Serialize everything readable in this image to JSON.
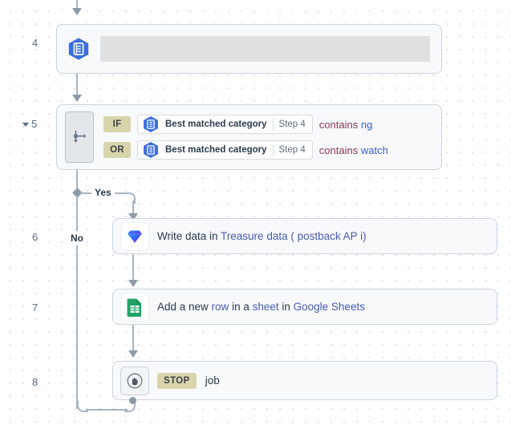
{
  "canvas": {
    "background_color": "#ffffff",
    "dot_color": "#dfe3e8"
  },
  "steps": [
    {
      "number": "4",
      "type": "loading",
      "icon": "blue-hexagon-document-icon",
      "collapsed_toggle": false,
      "placeholder_label": ""
    },
    {
      "number": "5",
      "type": "branch",
      "icon": "branch-fork-icon",
      "collapsed_toggle": true,
      "conditions": [
        {
          "logic": "IF",
          "field_icon": "blue-hexagon-document-icon",
          "field_name": "Best matched category",
          "field_step": "Step 4",
          "operator": "contains",
          "value": "ng"
        },
        {
          "logic": "OR",
          "field_icon": "blue-hexagon-document-icon",
          "field_name": "Best matched category",
          "field_step": "Step 4",
          "operator": "contains",
          "value": "watch"
        }
      ],
      "branches": [
        {
          "label": "Yes"
        },
        {
          "label": "No"
        }
      ]
    },
    {
      "number": "6",
      "type": "action",
      "icon": "treasure-data-gem-icon",
      "text_parts": [
        {
          "text": "Write data in ",
          "link": false
        },
        {
          "text": "Treasure data ( postback AP i)",
          "link": true
        }
      ]
    },
    {
      "number": "7",
      "type": "action",
      "icon": "google-sheets-icon",
      "text_parts": [
        {
          "text": "Add a new ",
          "link": false
        },
        {
          "text": "row",
          "link": true
        },
        {
          "text": " in a ",
          "link": false
        },
        {
          "text": "sheet",
          "link": true
        },
        {
          "text": " in ",
          "link": false
        },
        {
          "text": "Google Sheets",
          "link": true
        }
      ]
    },
    {
      "number": "8",
      "type": "stop",
      "icon": "stop-hand-icon",
      "badge": "STOP",
      "text": "job"
    }
  ],
  "colors": {
    "card_bg": "#f7f9fb",
    "card_border": "#ccd4de",
    "connector": "#a8b4c0",
    "logic_badge_bg": "#d8d5ad",
    "operator_text": "#8b3a52",
    "value_text": "#3b5bdb",
    "link_text": "#4a5bb5",
    "hex_icon": "#3b6fe0",
    "sheets_icon": "#21a366",
    "step_number": "#5a6b7d"
  }
}
